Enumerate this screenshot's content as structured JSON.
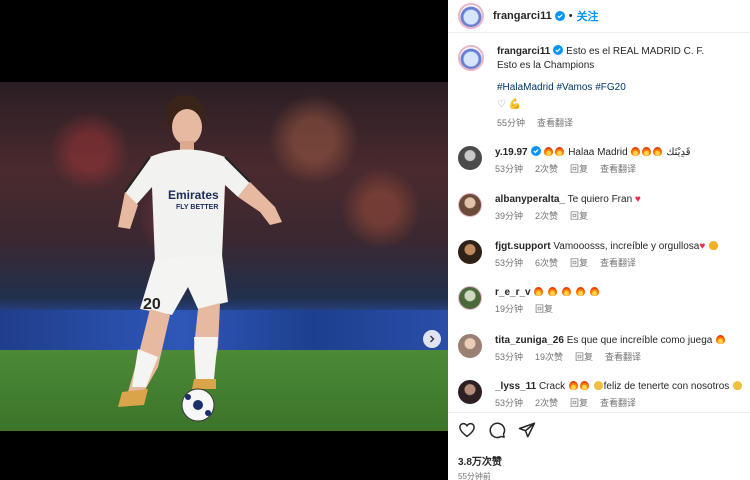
{
  "post": {
    "username": "frangarci11",
    "follow_label": "关注",
    "caption_line1": "Esto es el REAL MADRID C. F.",
    "caption_line2": "Esto es la Champions",
    "hashtags": "#HalaMadrid #Vamos #FG20",
    "caption_time": "55分钟",
    "see_translation": "查看翻译",
    "likes": "3.8万次赞",
    "posted_time": "55分钟前"
  },
  "comments": [
    {
      "username": "y.19.97",
      "text": "Halaa Madrid",
      "suffix": "قَدِيْتَك",
      "time": "53分钟",
      "likes": "2次赞",
      "reply": "回复",
      "translate": "查看翻译",
      "verified": true
    },
    {
      "username": "albanyperalta_",
      "text": "Te quiero Fran",
      "time": "39分钟",
      "likes": "2次赞",
      "reply": "回复"
    },
    {
      "username": "fjgt.support",
      "text": "Vamooosss, increíble y orgullosa",
      "time": "53分钟",
      "likes": "6次赞",
      "reply": "回复",
      "translate": "查看翻译"
    },
    {
      "username": "r_e_r_v",
      "text": "",
      "time": "19分钟",
      "reply": "回复"
    },
    {
      "username": "tita_zuniga_26",
      "text": "Es que que increíble como juega",
      "time": "53分钟",
      "likes": "19次赞",
      "reply": "回复",
      "translate": "查看翻译"
    },
    {
      "username": "_lyss_11",
      "text": "Crack",
      "text2": "feliz de tenerte con nosotros",
      "time": "53分钟",
      "likes": "2次赞",
      "reply": "回复",
      "translate": "查看翻译"
    }
  ],
  "jersey": {
    "sponsor": "Emirates",
    "sponsor2": "FLY BETTER",
    "number": "20"
  },
  "colors": {
    "accent": "#0095f6",
    "hashtag": "#00376b",
    "heart": "#ed2a4a",
    "verified": "#0095f6"
  },
  "icons": [
    "verified-icon",
    "heart-icon",
    "comment-icon",
    "share-icon",
    "next-arrow-icon",
    "fire-emoji",
    "heart-emoji"
  ]
}
